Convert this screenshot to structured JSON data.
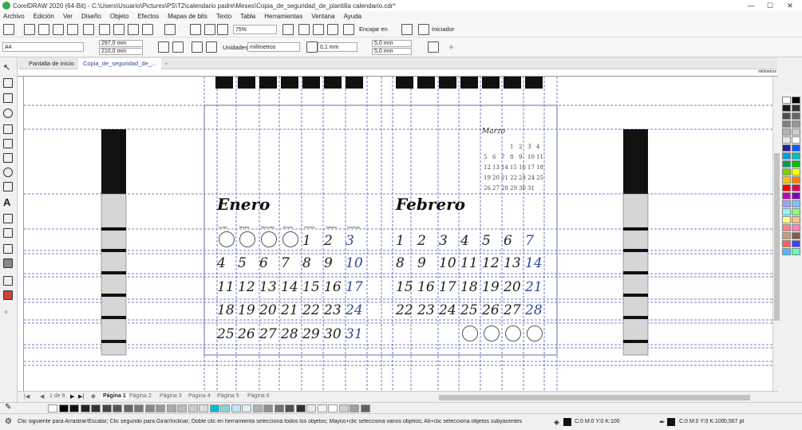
{
  "titlebar": {
    "title": "CorelDRAW 2020 (64-Bit) - C:\\Users\\Usuario\\Pictures\\PS\\T2\\calendario padre\\Meses\\Copia_de_seguridad_de_plantilla calendario.cdr*"
  },
  "menu": [
    "Archivo",
    "Edición",
    "Ver",
    "Diseño",
    "Objeto",
    "Efectos",
    "Mapas de bits",
    "Texto",
    "Tabla",
    "Herramientas",
    "Ventana",
    "Ayuda"
  ],
  "toolbar": {
    "zoom": "75%",
    "snap": "Encajar en",
    "start": "Iniciador"
  },
  "propbar": {
    "page_size": "A4",
    "width": "297,0 mm",
    "height": "210,0 mm",
    "units_label": "Unidades:",
    "units": "milímetros",
    "nudge": "0,1 mm",
    "dup_x": "5,0 mm",
    "dup_y": "5,0 mm"
  },
  "tabs": {
    "home": "Pantalla de inicio",
    "doc": "Copia_de_seguridad_de_..."
  },
  "ruler": {
    "units": "milímetros"
  },
  "calendar": {
    "jan": {
      "title": "Enero",
      "weekdays": [
        "Lunes",
        "Martes",
        "Miércoles",
        "Jueves",
        "Viernes",
        "Sábado",
        "Domingo"
      ],
      "days": [
        "1",
        "2",
        "3",
        "4",
        "5",
        "6",
        "7",
        "8",
        "9",
        "10",
        "11",
        "12",
        "13",
        "14",
        "15",
        "16",
        "17",
        "18",
        "19",
        "20",
        "21",
        "22",
        "23",
        "24",
        "25",
        "26",
        "27",
        "28",
        "29",
        "30",
        "31"
      ]
    },
    "feb": {
      "title": "Febrero",
      "days": [
        "1",
        "2",
        "3",
        "4",
        "5",
        "6",
        "7",
        "8",
        "9",
        "10",
        "11",
        "12",
        "13",
        "14",
        "15",
        "16",
        "17",
        "18",
        "19",
        "20",
        "21",
        "22",
        "23",
        "24",
        "25",
        "26",
        "27",
        "28"
      ]
    },
    "mini": {
      "title": "Marzo",
      "days": [
        "1",
        "2",
        "3",
        "4",
        "5",
        "6",
        "7",
        "8",
        "9",
        "10",
        "11",
        "12",
        "13",
        "14",
        "15",
        "16",
        "17",
        "18",
        "19",
        "20",
        "21",
        "22",
        "23",
        "24",
        "25",
        "26",
        "27",
        "28",
        "29",
        "30",
        "31"
      ]
    }
  },
  "pagebar": {
    "counter": "1 de 6",
    "pages": [
      "Página 1",
      "Página 2",
      "Página 3",
      "Página 4",
      "Página 5",
      "Página 6"
    ]
  },
  "status": {
    "hint": "Clic siguiente para Arrastrar/Escalar; Clic segundo para Girar/Inclinar; Doble clic en herramienta selecciona todos los objetos; Mayús+clic selecciona varios objetos; Alt+clic selecciona objetos subyacentes",
    "fill": "C:0 M:0 Y:0 K:100",
    "outline": "C:0 M:0 Y:0 K:100",
    "outline_width": "0,567 pt"
  },
  "colors": {
    "accent": "#2b4a9a",
    "guides": "#4a5ab5",
    "black": "#111111"
  }
}
